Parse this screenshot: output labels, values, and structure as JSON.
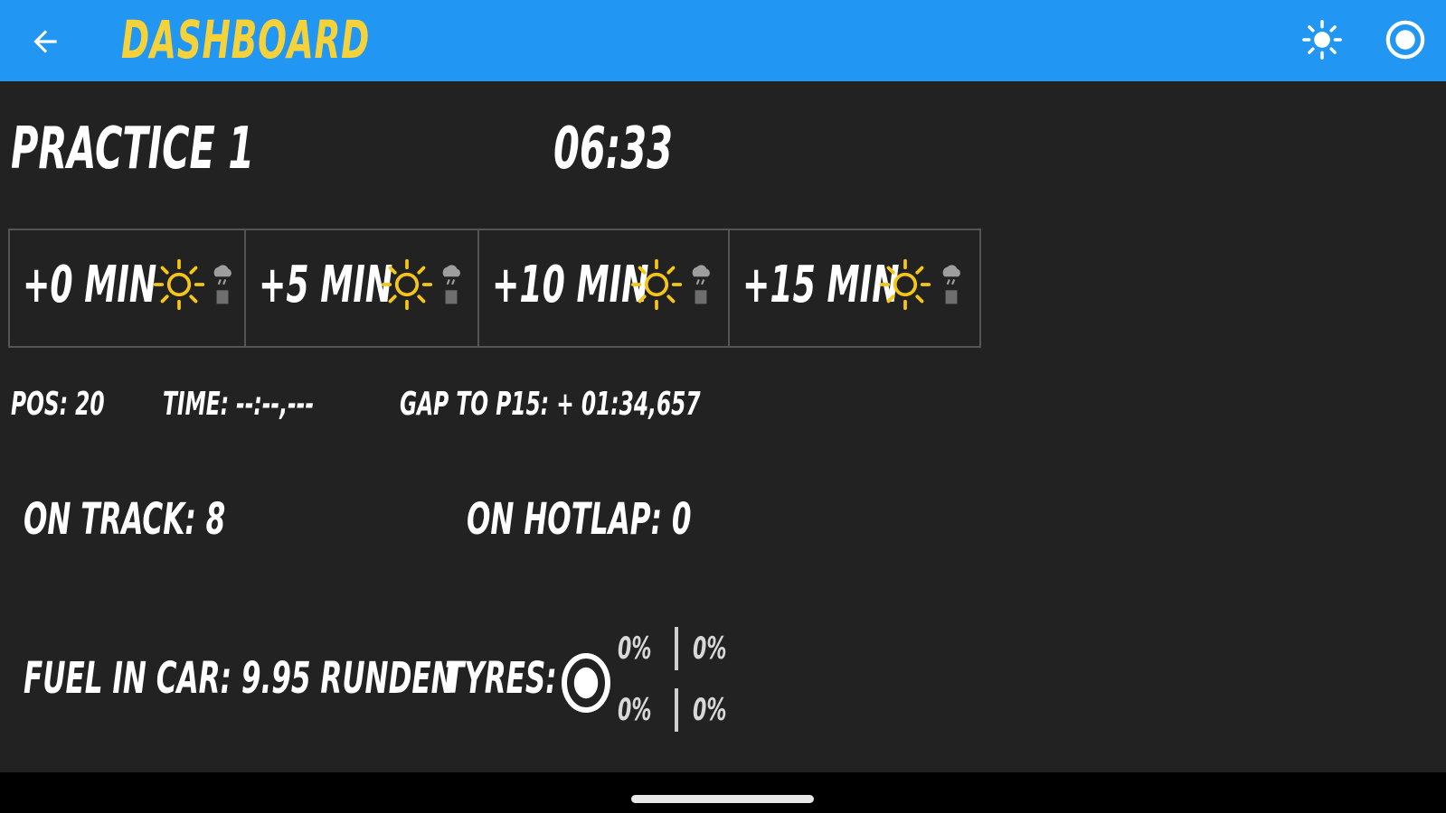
{
  "header": {
    "title": "DASHBOARD",
    "back_icon": "arrow-left-icon",
    "actions": [
      {
        "icon": "brightness-icon"
      },
      {
        "icon": "record-icon"
      }
    ],
    "background_color": "#2196f3",
    "title_color": "#f6d23a"
  },
  "session": {
    "name": "PRACTICE 1",
    "time_remaining": "06:33"
  },
  "forecast": [
    {
      "label": "+0 MIN",
      "weather_icon": "sun-icon",
      "rain_icon": "rain-cloud-icon"
    },
    {
      "label": "+5 MIN",
      "weather_icon": "sun-icon",
      "rain_icon": "rain-cloud-icon"
    },
    {
      "label": "+10 MIN",
      "weather_icon": "sun-icon",
      "rain_icon": "rain-cloud-icon"
    },
    {
      "label": "+15 MIN",
      "weather_icon": "sun-icon",
      "rain_icon": "rain-cloud-icon"
    }
  ],
  "stats": {
    "position": "POS: 20",
    "time": "TIME: --:--,---",
    "gap": "GAP TO P15: + 01:34,657",
    "on_track": "ON TRACK: 8",
    "on_hotlap": "ON HOTLAP: 0",
    "fuel": "FUEL IN CAR: 9.95 RUNDEN",
    "tyres_label": "TYRES:"
  },
  "tyres": {
    "icon": "tyre-icon",
    "front_left": "0%",
    "front_right": "0%",
    "rear_left": "0%",
    "rear_right": "0%"
  },
  "colors": {
    "background": "#222222",
    "sun": "#f5c518"
  }
}
